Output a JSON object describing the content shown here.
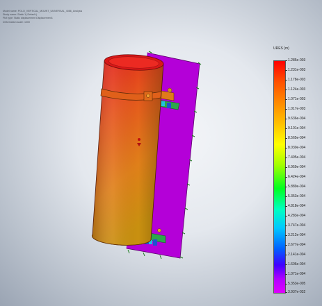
{
  "study_info": {
    "model_name": "Model name: POLO_VERTICAL_MOUNT_UNIVERSAL_4086_Analysis",
    "study_name": "Study name: Static 1(-Default-)",
    "plot_type": "Plot type: Static displacement Displacement1",
    "deformation_scale": "Deformation scale: 1000"
  },
  "legend": {
    "title": "URES (m)",
    "labels": [
      "1.285e-003",
      "1.231e-003",
      "1.178e-003",
      "1.124e-003",
      "1.071e-003",
      "1.017e-003",
      "9.636e-004",
      "9.101e-004",
      "8.565e-004",
      "8.030e-004",
      "7.495e-004",
      "6.959e-004",
      "6.424e-004",
      "5.889e-004",
      "5.353e-004",
      "4.818e-004",
      "4.283e-004",
      "3.747e-004",
      "3.212e-004",
      "2.677e-004",
      "2.141e-004",
      "1.606e-004",
      "1.071e-004",
      "5.353e-005",
      "3.937e-032"
    ],
    "gradient_colors": [
      "#ff0000",
      "#ff8a00",
      "#ffff00",
      "#00ff20",
      "#00c8ff",
      "#0060ff",
      "#e000ff"
    ]
  },
  "model": {
    "cylinder_colors": [
      "#e02020",
      "#e86a18",
      "#d8940a"
    ],
    "plate_color": "#b400d8"
  }
}
